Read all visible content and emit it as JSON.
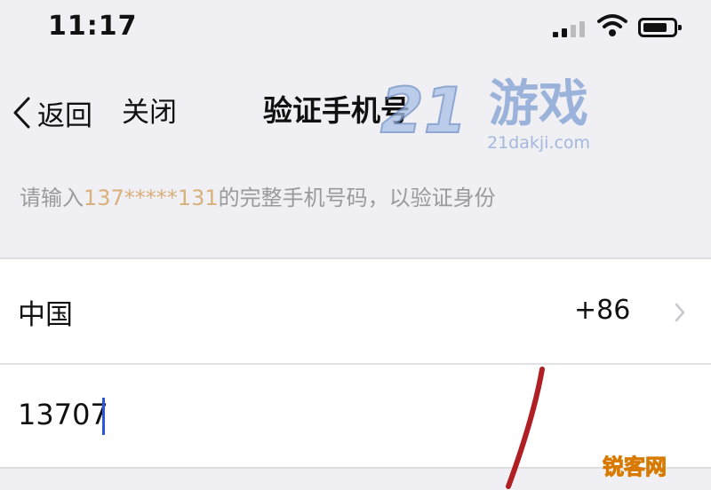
{
  "status_bar": {
    "time": "11:17"
  },
  "nav": {
    "back_label": "返回",
    "close_label": "关闭",
    "title": "验证手机号"
  },
  "hint": {
    "prefix": "请输入",
    "masked_number": "137*****131",
    "suffix": "的完整手机号码，以验证身份"
  },
  "form": {
    "country_name": "中国",
    "country_code": "+86",
    "phone_value": "13707"
  },
  "watermarks": {
    "top_number": "21",
    "top_brand": "游戏",
    "top_url": "21dakji.com",
    "bottom_brand": "锐客网"
  },
  "colors": {
    "background": "#efeff4",
    "masked_number": "#d9b07a",
    "caret": "#2b57d6"
  }
}
